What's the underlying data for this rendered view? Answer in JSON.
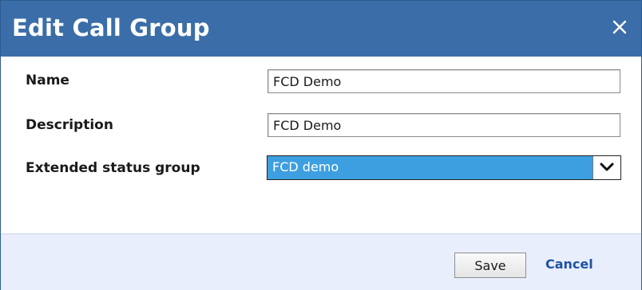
{
  "dialog": {
    "title": "Edit Call Group",
    "close_icon": "close-icon"
  },
  "form": {
    "name_label": "Name",
    "name_value": "FCD Demo",
    "description_label": "Description",
    "description_value": "FCD Demo",
    "extended_status_label": "Extended status group",
    "extended_status_value": "FCD demo",
    "extended_status_icon": "chevron-down-icon"
  },
  "footer": {
    "save_label": "Save",
    "cancel_label": "Cancel"
  },
  "colors": {
    "titlebar": "#3b6ea8",
    "select_highlight": "#3d9fe0",
    "footer": "#e8eefb",
    "link": "#1f52a3"
  }
}
